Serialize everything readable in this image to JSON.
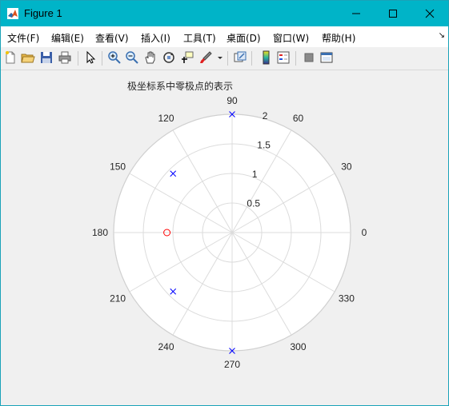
{
  "window": {
    "title": "Figure 1",
    "colors": {
      "titlebar": "#00b4c8",
      "background": "#f0f0f0"
    }
  },
  "menu": {
    "items": [
      "文件(F)",
      "编辑(E)",
      "查看(V)",
      "插入(I)",
      "工具(T)",
      "桌面(D)",
      "窗口(W)",
      "帮助(H)"
    ]
  },
  "toolbar": {
    "icons": [
      "new-figure-icon",
      "open-file-icon",
      "save-icon",
      "print-icon",
      "edit-plot-arrow-icon",
      "zoom-in-icon",
      "zoom-out-icon",
      "pan-hand-icon",
      "rotate-3d-icon",
      "data-cursor-icon",
      "brush-icon",
      "brush-dropdown-icon",
      "link-plot-icon",
      "colorbar-icon",
      "legend-icon",
      "hide-plot-tools-icon",
      "show-plot-tools-icon"
    ]
  },
  "chart_data": {
    "type": "scatter",
    "coordinate_system": "polar",
    "title": "极坐标系中零极点的表示",
    "angle_unit": "degrees",
    "angle_ticks": [
      0,
      30,
      60,
      90,
      120,
      150,
      180,
      210,
      240,
      270,
      300,
      330
    ],
    "radial_ticks": [
      0.5,
      1,
      1.5,
      2
    ],
    "rlim": [
      0,
      2
    ],
    "grid": true,
    "series": [
      {
        "marker": "x",
        "color": "#0000ff",
        "points": [
          {
            "theta": 90,
            "r": 2
          },
          {
            "theta": 135,
            "r": 1.41
          },
          {
            "theta": 225,
            "r": 1.41
          },
          {
            "theta": 270,
            "r": 2
          }
        ]
      },
      {
        "marker": "o",
        "color": "#ff0000",
        "points": [
          {
            "theta": 180,
            "r": 1.1
          }
        ]
      }
    ]
  }
}
